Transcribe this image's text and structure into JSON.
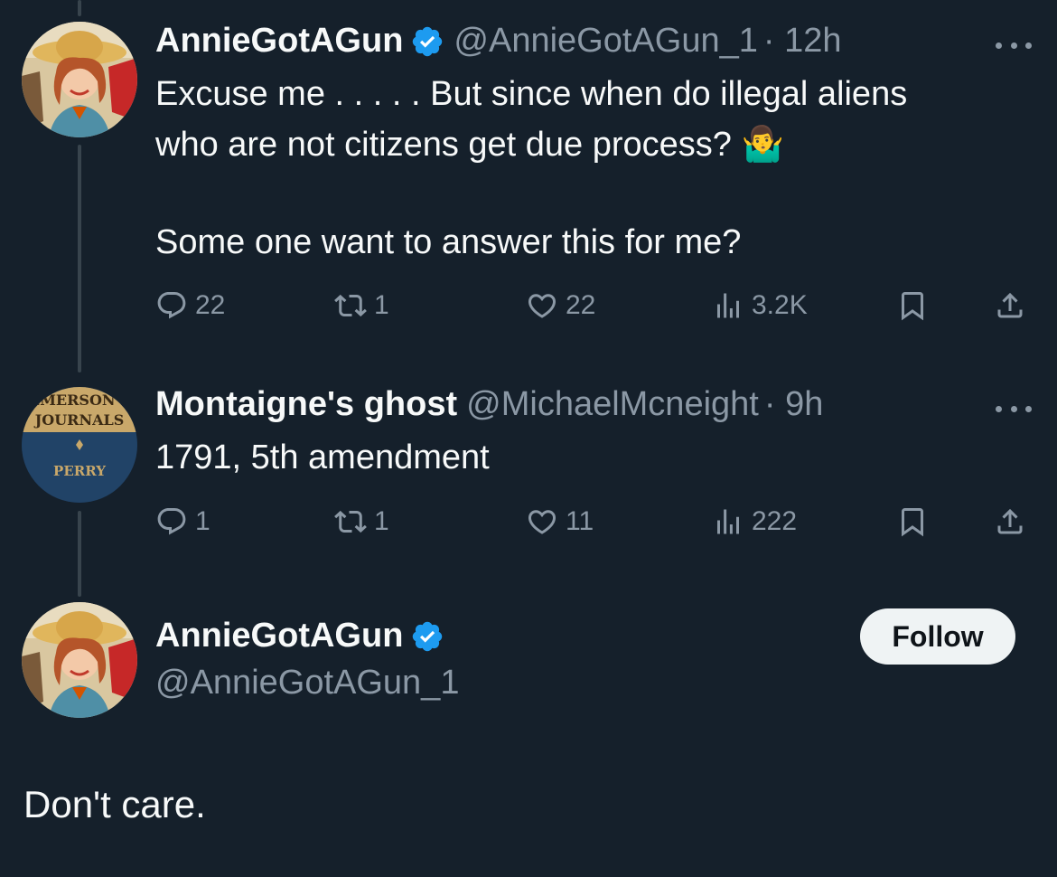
{
  "tweets": [
    {
      "name": "AnnieGotAGun",
      "handle": "@AnnieGotAGun_1",
      "time": "· 12h",
      "text_lines": [
        "Excuse me . . . . . But since when do illegal aliens",
        "who are not citizens get due process? 🤷‍♂️",
        "",
        "Some one want to answer this for me?"
      ],
      "replies": "22",
      "reposts": "1",
      "likes": "22",
      "views": "3.2K"
    },
    {
      "name": "Montaigne's ghost",
      "handle": "@MichaelMcneight",
      "time": "· 9h",
      "text": "1791, 5th amendment",
      "avatar_text": [
        "EMERSON'S",
        "JOURNALS",
        "PERRY"
      ],
      "replies": "1",
      "reposts": "1",
      "likes": "11",
      "views": "222"
    }
  ],
  "reply_author": {
    "name": "AnnieGotAGun",
    "handle": "@AnnieGotAGun_1",
    "follow_label": "Follow"
  },
  "reply_text": "Don't care.",
  "colors": {
    "background": "#15202b",
    "text": "#f7f9f9",
    "secondary": "#8b98a5",
    "verified": "#1d9bf0"
  }
}
